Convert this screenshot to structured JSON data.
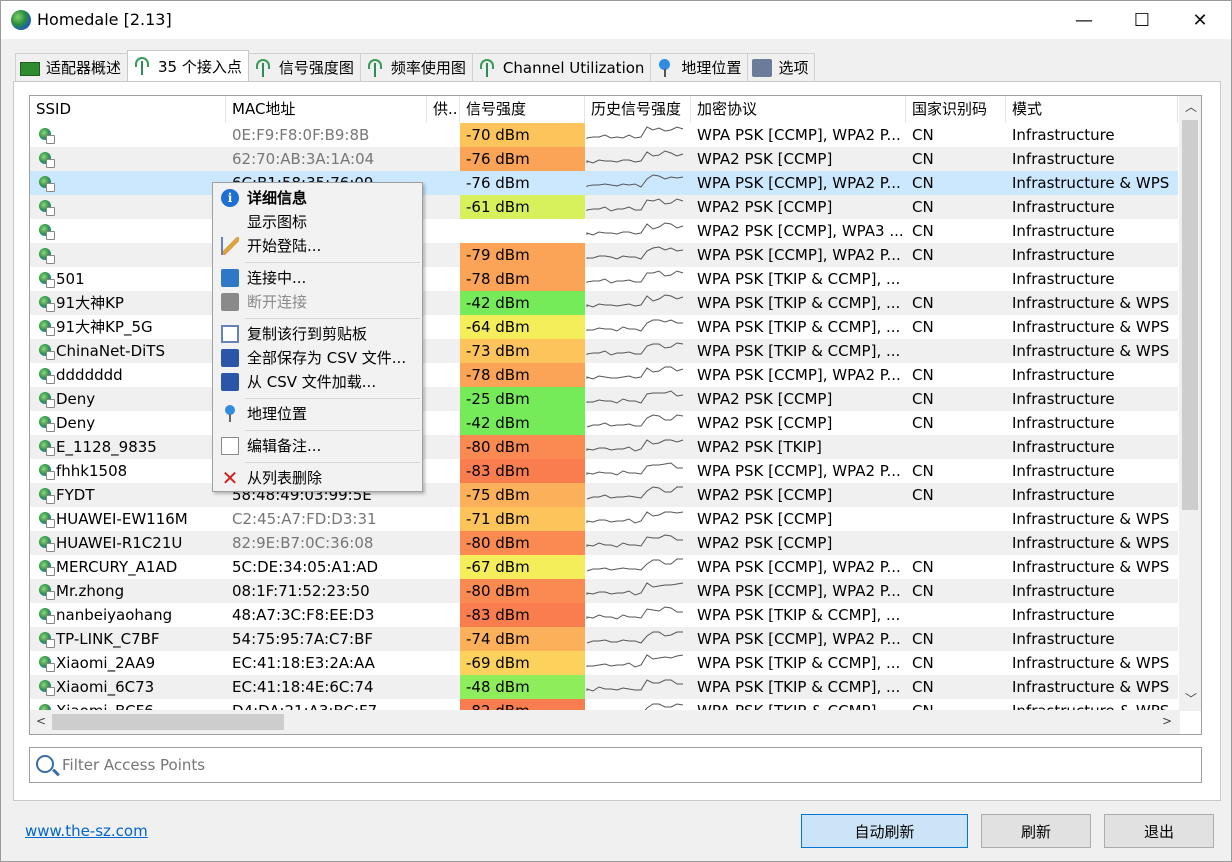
{
  "window": {
    "title": "Homedale [2.13]",
    "minimize": "—",
    "maximize": "☐",
    "close": "✕"
  },
  "tabs": [
    {
      "label": "适配器概述",
      "icon": "network-card-icon"
    },
    {
      "label": "35 个接入点",
      "icon": "antenna-icon"
    },
    {
      "label": "信号强度图",
      "icon": "antenna-icon"
    },
    {
      "label": "频率使用图",
      "icon": "antenna-icon"
    },
    {
      "label": "Channel Utilization",
      "icon": "antenna-icon"
    },
    {
      "label": "地理位置",
      "icon": "map-pin-icon"
    },
    {
      "label": "选项",
      "icon": "options-icon"
    }
  ],
  "columns": [
    "SSID",
    "MAC地址",
    "供..",
    "信号强度",
    "历史信号强度",
    "加密协议",
    "国家识别码",
    "模式"
  ],
  "colors": {
    "sig_red": "#fa7d50",
    "sig_orange": "#fba357",
    "sig_lightorange": "#fdc45c",
    "sig_yellow": "#f4ee5a",
    "sig_lime": "#d6f15c",
    "sig_green": "#76eb5a",
    "selection": "#cce8ff",
    "link": "#0066cc"
  },
  "rows": [
    {
      "ssid": "",
      "mac": "0E:F9:F8:0F:B9:8B",
      "mac_gray": true,
      "signal": "-70 dBm",
      "sig_color": "#fdc45c",
      "enc": "WPA PSK [CCMP], WPA2 P...",
      "cc": "CN",
      "mode": "Infrastructure"
    },
    {
      "ssid": "",
      "mac": "62:70:AB:3A:1A:04",
      "mac_gray": true,
      "signal": "-76 dBm",
      "sig_color": "#fba357",
      "enc": "WPA2 PSK [CCMP]",
      "cc": "CN",
      "mode": "Infrastructure"
    },
    {
      "ssid": "",
      "mac": "6C:B1:58:35:76:09",
      "mac_gray": false,
      "signal": "-76 dBm",
      "sig_color": "",
      "enc": "WPA PSK [CCMP], WPA2 P...",
      "cc": "CN",
      "mode": "Infrastructure & WPS",
      "selected": true
    },
    {
      "ssid": "",
      "mac": "",
      "mac_gray": false,
      "signal": "-61 dBm",
      "sig_color": "#d6f15c",
      "enc": "WPA2 PSK [CCMP]",
      "cc": "CN",
      "mode": "Infrastructure"
    },
    {
      "ssid": "",
      "mac": "",
      "mac_gray": false,
      "signal": "",
      "sig_color": "",
      "enc": "WPA2 PSK [CCMP], WPA3 ...",
      "cc": "CN",
      "mode": "Infrastructure"
    },
    {
      "ssid": "",
      "mac": "",
      "mac_gray": false,
      "signal": "-79 dBm",
      "sig_color": "#fba357",
      "enc": "WPA PSK [CCMP], WPA2 P...",
      "cc": "CN",
      "mode": "Infrastructure"
    },
    {
      "ssid": "501",
      "mac": "",
      "mac_gray": false,
      "signal": "-78 dBm",
      "sig_color": "#fba357",
      "enc": "WPA PSK [TKIP & CCMP], ...",
      "cc": "",
      "mode": "Infrastructure"
    },
    {
      "ssid": "91大神KP",
      "mac": "",
      "mac_gray": false,
      "signal": "-42 dBm",
      "sig_color": "#76eb5a",
      "enc": "WPA PSK [TKIP & CCMP], ...",
      "cc": "CN",
      "mode": "Infrastructure & WPS"
    },
    {
      "ssid": "91大神KP_5G",
      "mac": "",
      "mac_gray": false,
      "signal": "-64 dBm",
      "sig_color": "#f4ee5a",
      "enc": "WPA PSK [TKIP & CCMP], ...",
      "cc": "CN",
      "mode": "Infrastructure & WPS"
    },
    {
      "ssid": "ChinaNet-DiTS",
      "mac": "",
      "mac_gray": false,
      "signal": "-73 dBm",
      "sig_color": "#fdc45c",
      "enc": "WPA PSK [TKIP & CCMP], ...",
      "cc": "",
      "mode": "Infrastructure & WPS"
    },
    {
      "ssid": "ddddddd",
      "mac": "",
      "mac_gray": false,
      "signal": "-78 dBm",
      "sig_color": "#fba357",
      "enc": "WPA PSK [CCMP], WPA2 P...",
      "cc": "CN",
      "mode": "Infrastructure"
    },
    {
      "ssid": "Deny",
      "mac": "",
      "mac_gray": false,
      "signal": "-25 dBm",
      "sig_color": "#76eb5a",
      "enc": "WPA2 PSK [CCMP]",
      "cc": "CN",
      "mode": "Infrastructure"
    },
    {
      "ssid": "Deny",
      "mac": "",
      "mac_gray": false,
      "signal": "-42 dBm",
      "sig_color": "#76eb5a",
      "enc": "WPA2 PSK [CCMP]",
      "cc": "CN",
      "mode": "Infrastructure"
    },
    {
      "ssid": "E_1128_9835",
      "mac": "",
      "mac_gray": false,
      "signal": "-80 dBm",
      "sig_color": "#fa8a52",
      "enc": "WPA2 PSK [TKIP]",
      "cc": "",
      "mode": "Infrastructure"
    },
    {
      "ssid": "fhhk1508",
      "mac": "",
      "mac_gray": false,
      "signal": "-83 dBm",
      "sig_color": "#fa7d50",
      "enc": "WPA PSK [CCMP], WPA2 P...",
      "cc": "CN",
      "mode": "Infrastructure"
    },
    {
      "ssid": "FYDT",
      "mac": "58:48:49:03:99:5E",
      "mac_gray": false,
      "signal": "-75 dBm",
      "sig_color": "#fdb05a",
      "enc": "WPA2 PSK [CCMP]",
      "cc": "CN",
      "mode": "Infrastructure"
    },
    {
      "ssid": "HUAWEI-EW116M",
      "mac": "C2:45:A7:FD:D3:31",
      "mac_gray": true,
      "signal": "-71 dBm",
      "sig_color": "#fdc45c",
      "enc": "WPA2 PSK [CCMP]",
      "cc": "",
      "mode": "Infrastructure & WPS"
    },
    {
      "ssid": "HUAWEI-R1C21U",
      "mac": "82:9E:B7:0C:36:08",
      "mac_gray": true,
      "signal": "-80 dBm",
      "sig_color": "#fa8a52",
      "enc": "WPA2 PSK [CCMP]",
      "cc": "",
      "mode": "Infrastructure & WPS"
    },
    {
      "ssid": "MERCURY_A1AD",
      "mac": "5C:DE:34:05:A1:AD",
      "mac_gray": false,
      "signal": "-67 dBm",
      "sig_color": "#f4ee5a",
      "enc": "WPA PSK [CCMP], WPA2 P...",
      "cc": "CN",
      "mode": "Infrastructure & WPS"
    },
    {
      "ssid": "Mr.zhong",
      "mac": "08:1F:71:52:23:50",
      "mac_gray": false,
      "signal": "-80 dBm",
      "sig_color": "#fa8a52",
      "enc": "WPA PSK [CCMP], WPA2 P...",
      "cc": "CN",
      "mode": "Infrastructure"
    },
    {
      "ssid": "nanbeiyaohang",
      "mac": "48:A7:3C:F8:EE:D3",
      "mac_gray": false,
      "signal": "-83 dBm",
      "sig_color": "#fa7d50",
      "enc": "WPA PSK [TKIP & CCMP], ...",
      "cc": "",
      "mode": "Infrastructure"
    },
    {
      "ssid": "TP-LINK_C7BF",
      "mac": "54:75:95:7A:C7:BF",
      "mac_gray": false,
      "signal": "-74 dBm",
      "sig_color": "#fdb05a",
      "enc": "WPA PSK [CCMP], WPA2 P...",
      "cc": "CN",
      "mode": "Infrastructure"
    },
    {
      "ssid": "Xiaomi_2AA9",
      "mac": "EC:41:18:E3:2A:AA",
      "mac_gray": false,
      "signal": "-69 dBm",
      "sig_color": "#fdd25c",
      "enc": "WPA PSK [TKIP & CCMP], ...",
      "cc": "CN",
      "mode": "Infrastructure & WPS"
    },
    {
      "ssid": "Xiaomi_6C73",
      "mac": "EC:41:18:4E:6C:74",
      "mac_gray": false,
      "signal": "-48 dBm",
      "sig_color": "#8eed5a",
      "enc": "WPA PSK [TKIP & CCMP], ...",
      "cc": "CN",
      "mode": "Infrastructure & WPS"
    },
    {
      "ssid": "Xiaomi_BCF6",
      "mac": "D4:DA:21:A3:BC:F7",
      "mac_gray": false,
      "signal": "-82 dBm",
      "sig_color": "#fa7d50",
      "enc": "WPA PSK [TKIP & CCMP], ...",
      "cc": "CN",
      "mode": "Infrastructure & WPS"
    }
  ],
  "context_menu": [
    {
      "label": "详细信息",
      "icon": "info-icon",
      "bold": true,
      "disabled": false
    },
    {
      "label": "显示图标",
      "icon": "",
      "bold": false,
      "disabled": false
    },
    {
      "label": "开始登陆...",
      "icon": "pen-icon",
      "bold": false,
      "disabled": false
    },
    {
      "sep": true
    },
    {
      "label": "连接中...",
      "icon": "connect-icon",
      "bold": false,
      "disabled": false
    },
    {
      "label": "断开连接",
      "icon": "disconnect-icon",
      "bold": false,
      "disabled": true
    },
    {
      "sep": true
    },
    {
      "label": "复制该行到剪贴板",
      "icon": "copy-icon",
      "bold": false,
      "disabled": false
    },
    {
      "label": "全部保存为 CSV 文件...",
      "icon": "save-icon",
      "bold": false,
      "disabled": false
    },
    {
      "label": "从 CSV 文件加载...",
      "icon": "load-icon",
      "bold": false,
      "disabled": false
    },
    {
      "sep": true
    },
    {
      "label": "地理位置",
      "icon": "map-pin-icon",
      "bold": false,
      "disabled": false
    },
    {
      "sep": true
    },
    {
      "label": "编辑备注...",
      "icon": "note-icon",
      "bold": false,
      "disabled": false
    },
    {
      "sep": true
    },
    {
      "label": "从列表删除",
      "icon": "delete-icon",
      "bold": false,
      "disabled": false
    }
  ],
  "filter": {
    "placeholder": "Filter Access Points"
  },
  "footer": {
    "link": "www.the-sz.com",
    "auto_refresh": "自动刷新",
    "refresh": "刷新",
    "exit": "退出"
  }
}
